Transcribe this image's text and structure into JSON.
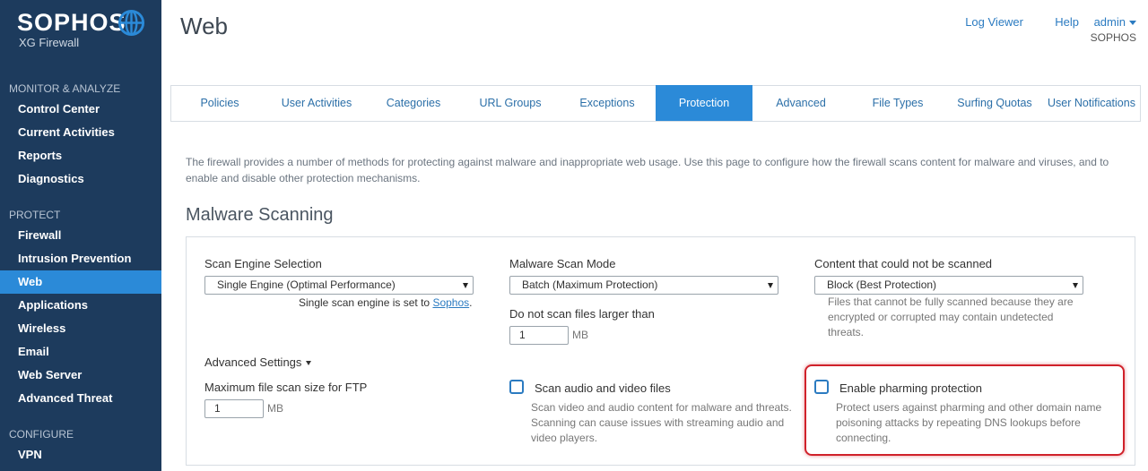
{
  "brand": {
    "name": "SOPHOS",
    "product": "XG Firewall"
  },
  "sidebar": {
    "sections": [
      {
        "title": "MONITOR & ANALYZE",
        "items": [
          "Control Center",
          "Current Activities",
          "Reports",
          "Diagnostics"
        ]
      },
      {
        "title": "PROTECT",
        "items": [
          "Firewall",
          "Intrusion Prevention",
          "Web",
          "Applications",
          "Wireless",
          "Email",
          "Web Server",
          "Advanced Threat"
        ]
      },
      {
        "title": "CONFIGURE",
        "items": [
          "VPN"
        ]
      }
    ],
    "active_item": "Web"
  },
  "header": {
    "title": "Web",
    "links": [
      "Log Viewer",
      "Help",
      "admin"
    ],
    "org": "SOPHOS"
  },
  "tabs": [
    "Policies",
    "User Activities",
    "Categories",
    "URL Groups",
    "Exceptions",
    "Protection",
    "Advanced",
    "File Types",
    "Surfing Quotas",
    "User Notifications"
  ],
  "active_tab": "Protection",
  "description": "The firewall provides a number of methods for protecting against malware and inappropriate web usage. Use this page to configure how the firewall scans content for malware and viruses, and to enable and disable other protection mechanisms.",
  "malware": {
    "section_title": "Malware Scanning",
    "scan_engine": {
      "label": "Scan Engine Selection",
      "value": "Single Engine (Optimal Performance)",
      "note_prefix": "Single scan engine is set to ",
      "note_link": "Sophos",
      "note_suffix": "."
    },
    "scan_mode": {
      "label": "Malware Scan Mode",
      "value": "Batch (Maximum Protection)"
    },
    "max_size": {
      "label": "Do not scan files larger than",
      "value": "1",
      "unit": "MB"
    },
    "unscannable": {
      "label": "Content that could not be scanned",
      "value": "Block (Best Protection)",
      "help": "Files that cannot be fully scanned because they are encrypted or corrupted may contain undetected threats."
    },
    "advanced_settings": "Advanced Settings",
    "ftp": {
      "label": "Maximum file scan size for FTP",
      "value": "1",
      "unit": "MB"
    },
    "audio_video": {
      "label": "Scan audio and video files",
      "help": "Scan video and audio content for malware and threats. Scanning can cause issues with streaming audio and video players.",
      "checked": false
    },
    "pharming": {
      "label": "Enable pharming protection",
      "help": "Protect users against pharming and other domain name poisoning attacks by repeating DNS lookups before connecting.",
      "checked": false
    }
  },
  "colors": {
    "sidebar_bg": "#1d3b5d",
    "accent": "#2b8ad8",
    "highlight": "#d0212a"
  }
}
